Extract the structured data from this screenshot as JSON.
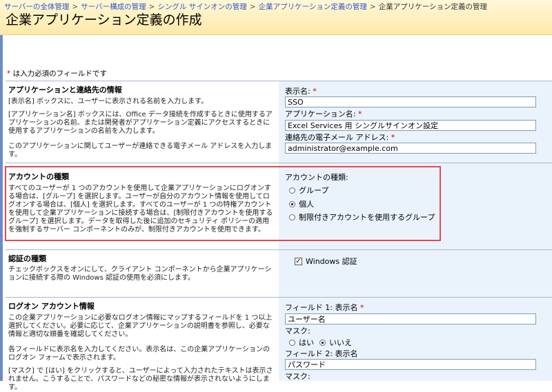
{
  "breadcrumb": [
    "サーバーの全体管理",
    "サーバー構成の管理",
    "シングル サインオンの管理",
    "企業アプリケーション定義の管理"
  ],
  "breadcrumb_current": "企業アプリケーション定義の管理",
  "page_title": "企業アプリケーション定義の作成",
  "required_note": {
    "star": "*",
    "text": " は入力必須のフィールドです"
  },
  "sections": {
    "app_info": {
      "title": "アプリケーションと連絡先の情報",
      "desc1": "[表示名] ボックスに、ユーザーに表示される名前を入力します。",
      "desc2": "[アプリケーション名] ボックスには、Office データ接続を作成するときに使用するアプリケーションの名前、または開発者がアプリケーション定義にアクセスするときに使用するアプリケーションの名前を入力します。",
      "desc3": "このアプリケーションに関してユーザーが連絡できる電子メール アドレスを入力します。",
      "display_name_label": "表示名:",
      "display_name_value": "SSO",
      "app_name_label": "アプリケーション名:",
      "app_name_value": "Excel Services 用 シングルサインオン設定",
      "email_label": "連絡先の電子メール アドレス:",
      "email_value": "administrator@example.com"
    },
    "account": {
      "title": "アカウントの種類",
      "desc": "すべてのユーザーが 1 つのアカウントを使用して企業アプリケーションにログオンする場合は、[グループ] を選択します。ユーザーが自分のアカウント情報を使用してログオンする場合は、[個人] を選択します。すべてのユーザーが 1 つの特権アカウントを使用して企業アプリケーションに接続する場合は、[制限付きアカウントを使用するグループ] を選択します。データを取得した後に追加のセキュリティ ポリシーの適用を強制するサーバー コンポーネントのみが、制限付きアカウントを使用できます。",
      "label": "アカウントの種類:",
      "options": [
        "グループ",
        "個人",
        "制限付きアカウントを使用するグループ"
      ],
      "selected_index": 1
    },
    "auth": {
      "title": "認証の種類",
      "desc": "チェックボックスをオンにして、クライアント コンポーネントから企業アプリケーションに接続する際の Windows 認証の使用を必須にします。",
      "checkbox_label": "Windows 認証",
      "checked": true
    },
    "logon": {
      "title": "ログオン アカウント情報",
      "desc1": "この企業アプリケーションに必要なログオン情報にマップするフィールドを 1 つ以上選択してください。必要に応じて、企業アプリケーションの説明書を参照し、必要な情報と適切な順番を確認してください。",
      "desc2": "各フィールドに表示名を入力してください。表示名は、この企業アプリケーションのログオン フォームで表示されます。",
      "desc3": "[マスク] で [はい] をクリックすると、ユーザーによって入力されたテキストは表示されません。こうすることで、パスワードなどの秘密な情報が表示されないようにします。",
      "field1_label": "フィールド 1: 表示名",
      "field1_value": "ユーザー名",
      "mask_label": "マスク:",
      "mask_yes": "はい",
      "mask_no": "いいえ",
      "field1_mask_selected": "no",
      "field2_label": "フィールド 2: 表示名",
      "field2_value": "パスワード",
      "mask2_label": "マスク:"
    }
  }
}
